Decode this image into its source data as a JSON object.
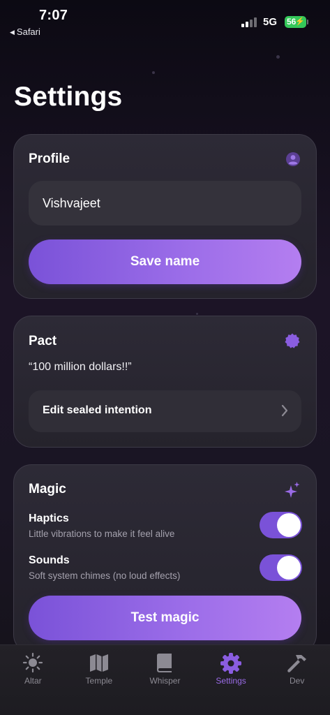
{
  "status_bar": {
    "time": "7:07",
    "back_app": "Safari",
    "network": "5G",
    "battery": "56"
  },
  "page": {
    "title": "Settings"
  },
  "profile": {
    "title": "Profile",
    "icon": "person-circle-icon",
    "name_value": "Vishvajeet",
    "save_label": "Save name"
  },
  "pact": {
    "title": "Pact",
    "icon": "seal-badge-icon",
    "quote": "“100 million dollars!!”",
    "edit_label": "Edit sealed intention"
  },
  "magic": {
    "title": "Magic",
    "icon": "sparkles-icon",
    "haptics": {
      "label": "Haptics",
      "description": "Little vibrations to make it feel alive",
      "on": true
    },
    "sounds": {
      "label": "Sounds",
      "description": "Soft system chimes (no loud effects)",
      "on": true
    },
    "test_label": "Test magic"
  },
  "tabs": [
    {
      "label": "Altar",
      "icon": "sun-icon",
      "active": false
    },
    {
      "label": "Temple",
      "icon": "map-icon",
      "active": false
    },
    {
      "label": "Whisper",
      "icon": "book-icon",
      "active": false
    },
    {
      "label": "Settings",
      "icon": "gear-icon",
      "active": true
    },
    {
      "label": "Dev",
      "icon": "hammer-icon",
      "active": false
    }
  ],
  "colors": {
    "accent": "#8a5de0",
    "accent_light": "#b47ef0",
    "card_bg": "#2a2731",
    "inactive_tab": "#8c8a93",
    "battery_green": "#34c759"
  }
}
